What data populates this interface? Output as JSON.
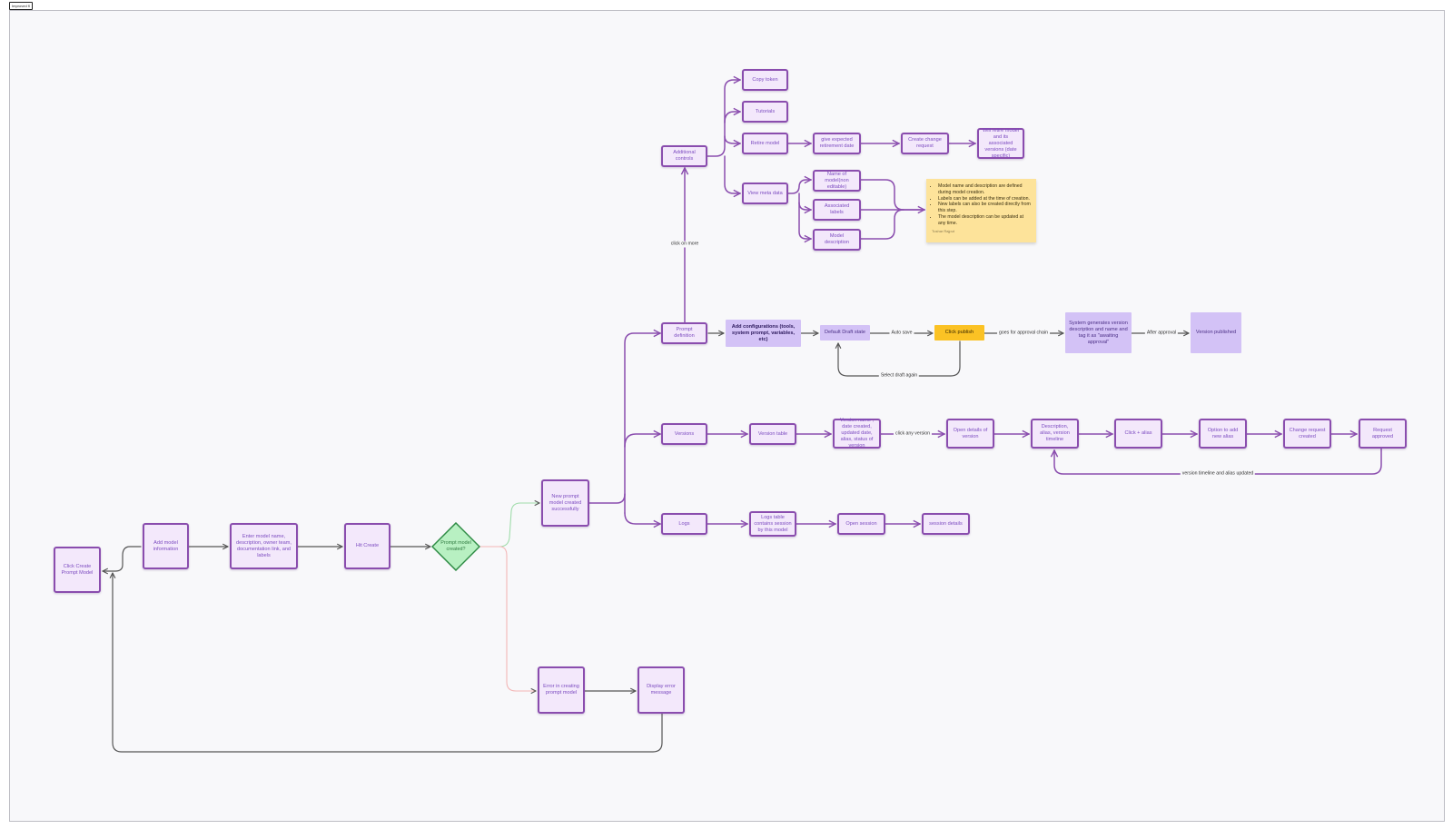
{
  "frame_tag": "Improved fl",
  "nodes": {
    "click_create": "Click Create Prompt Model",
    "add_model_info": "Add model information",
    "enter_model_name": "Enter model name, description, owner team, documentation link, and labels",
    "hit_create": "Hit Create",
    "decision": "Prompt model created?",
    "new_prompt_model": "New prompt model created successfully",
    "error_creating": "Error in creating prompt model",
    "display_error": "Display error message",
    "additional_controls": "Additional controls",
    "copy_token": "Copy token",
    "tutorials": "Tutorials",
    "retire_model": "Retire model",
    "give_expected": "give expected retirement date",
    "create_change_request": "Create change request",
    "will_retire": "Will retire  model and its associated versions (date specific)",
    "view_meta_data": "View meta data",
    "name_of_model": "Name of model(non editable)",
    "associated_labels": "Associated labels",
    "model_description": "Model description",
    "prompt_definition": "Prompt definition",
    "add_configurations": "Add configurations (tools, system prompt, variables, etc)",
    "default_draft": "Default Draft state",
    "click_publish": "Click publish",
    "system_generates": "System generates version description and name and tag it as \"awaiting approval\"",
    "version_published": "Version published",
    "versions": "Versions",
    "version_table": "Version table",
    "version_name_date": "Version name , date created, updated date, alias, status of version",
    "open_details": "Open details of version",
    "description_alias": "Description, alias, version timeline",
    "click_alias": "Click + alias",
    "option_add_alias": "Option to add new alias",
    "change_request_created": "Change request created",
    "request_approved": "Request approved",
    "logs": "Logs",
    "logs_table": "Logs table contains session by this model",
    "open_session": "Open session",
    "session_details": "session details"
  },
  "edge_labels": {
    "click_on_more": "click on more",
    "auto_save": "Auto save",
    "goes_for_approval": "goes for approval chain",
    "after_approval": "After approval",
    "select_draft_again": "Select draft again",
    "click_any_version": "click any version",
    "version_timeline_updated": "version timeline and alias updated"
  },
  "sticky": {
    "bullets": [
      "Model name and description are defined during model creation.",
      "Labels can be added at the time of creation.",
      "New labels can also be created directly from this step.",
      "The model description can be updated at any time."
    ],
    "author": "Tushar Rajput"
  },
  "colors": {
    "node_fill": "#f3e8fb",
    "node_border": "#8a4dae",
    "node_text": "#7c4bc0",
    "filled_node": "#d3c2f6",
    "publish": "#fbc224",
    "sticky": "#fde39a",
    "decision_fill": "#b8f0c2",
    "decision_border": "#2e8b44",
    "edge_purple": "#8a4dae",
    "edge_gray": "#555555",
    "edge_green": "#9fdcaa",
    "edge_pink": "#f3b6b6"
  }
}
